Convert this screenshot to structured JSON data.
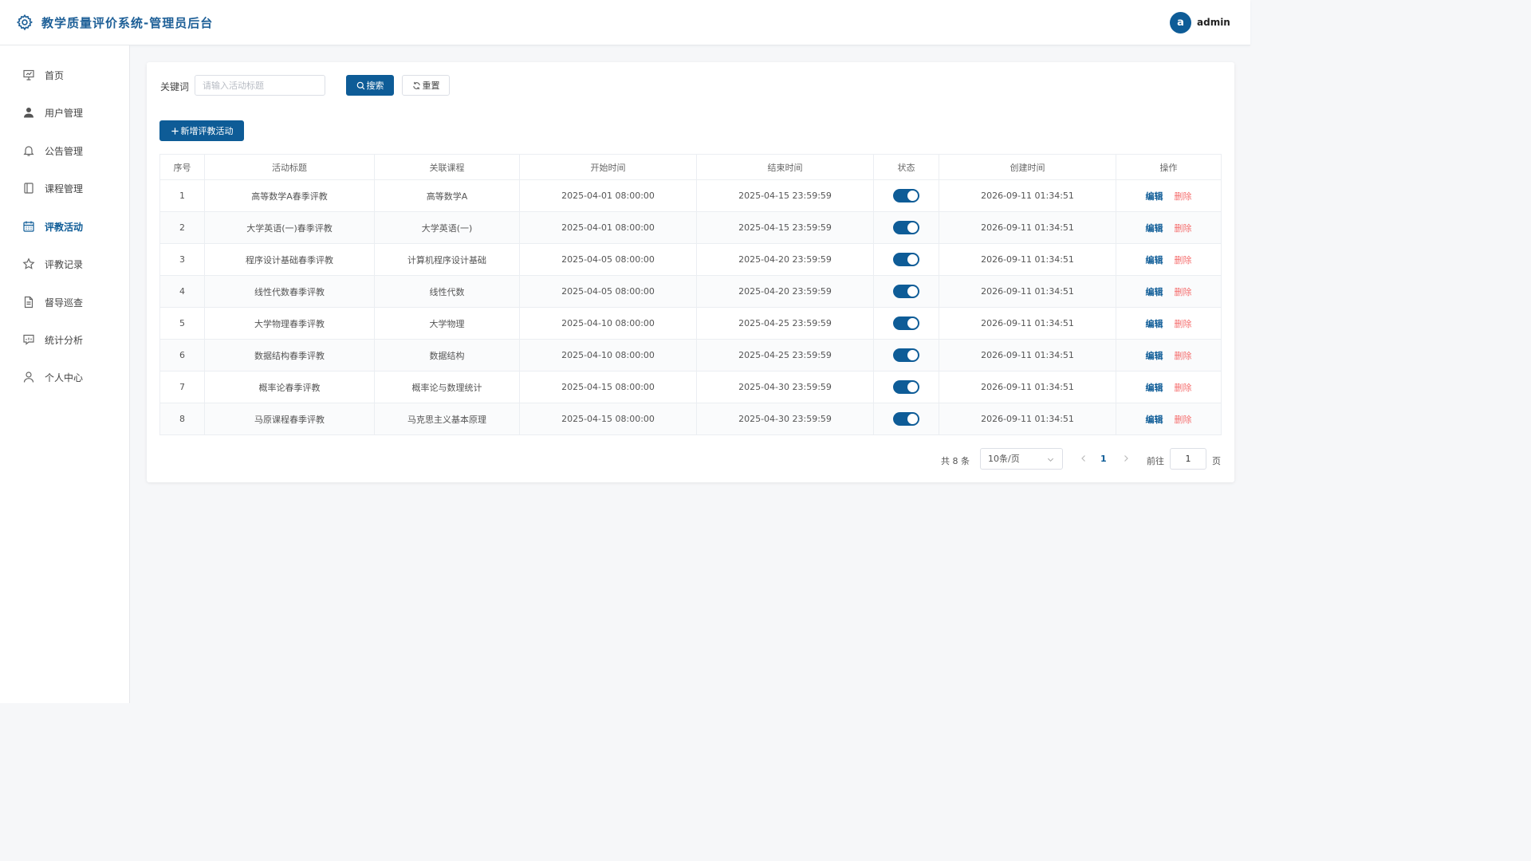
{
  "header": {
    "title": "教学质量评价系统-管理员后台",
    "avatar_letter": "a",
    "username": "admin"
  },
  "sidebar": {
    "items": [
      {
        "label": "首页",
        "icon": "presentation-icon"
      },
      {
        "label": "用户管理",
        "icon": "user-icon"
      },
      {
        "label": "公告管理",
        "icon": "bell-icon"
      },
      {
        "label": "课程管理",
        "icon": "notebook-icon"
      },
      {
        "label": "评教活动",
        "icon": "calendar-icon",
        "active": true
      },
      {
        "label": "评教记录",
        "icon": "star-icon"
      },
      {
        "label": "督导巡查",
        "icon": "document-icon"
      },
      {
        "label": "统计分析",
        "icon": "chat-chart-icon"
      },
      {
        "label": "个人中心",
        "icon": "user-outline-icon"
      }
    ]
  },
  "search": {
    "keyword_label": "关键词",
    "placeholder": "请输入活动标题",
    "value": "",
    "search_label": "搜索",
    "reset_label": "重置"
  },
  "toolbar": {
    "add_label": "新增评教活动"
  },
  "table": {
    "columns": [
      "序号",
      "活动标题",
      "关联课程",
      "开始时间",
      "结束时间",
      "状态",
      "创建时间",
      "操作"
    ],
    "edit_label": "编辑",
    "delete_label": "删除",
    "rows": [
      {
        "no": "1",
        "title": "高等数学A春季评教",
        "course": "高等数学A",
        "start": "2025-04-01 08:00:00",
        "end": "2025-04-15 23:59:59",
        "enabled": true,
        "created": "2026-09-11 01:34:51"
      },
      {
        "no": "2",
        "title": "大学英语(一)春季评教",
        "course": "大学英语(一)",
        "start": "2025-04-01 08:00:00",
        "end": "2025-04-15 23:59:59",
        "enabled": true,
        "created": "2026-09-11 01:34:51"
      },
      {
        "no": "3",
        "title": "程序设计基础春季评教",
        "course": "计算机程序设计基础",
        "start": "2025-04-05 08:00:00",
        "end": "2025-04-20 23:59:59",
        "enabled": true,
        "created": "2026-09-11 01:34:51"
      },
      {
        "no": "4",
        "title": "线性代数春季评教",
        "course": "线性代数",
        "start": "2025-04-05 08:00:00",
        "end": "2025-04-20 23:59:59",
        "enabled": true,
        "created": "2026-09-11 01:34:51"
      },
      {
        "no": "5",
        "title": "大学物理春季评教",
        "course": "大学物理",
        "start": "2025-04-10 08:00:00",
        "end": "2025-04-25 23:59:59",
        "enabled": true,
        "created": "2026-09-11 01:34:51"
      },
      {
        "no": "6",
        "title": "数据结构春季评教",
        "course": "数据结构",
        "start": "2025-04-10 08:00:00",
        "end": "2025-04-25 23:59:59",
        "enabled": true,
        "created": "2026-09-11 01:34:51"
      },
      {
        "no": "7",
        "title": "概率论春季评教",
        "course": "概率论与数理统计",
        "start": "2025-04-15 08:00:00",
        "end": "2025-04-30 23:59:59",
        "enabled": true,
        "created": "2026-09-11 01:34:51"
      },
      {
        "no": "8",
        "title": "马原课程春季评教",
        "course": "马克思主义基本原理",
        "start": "2025-04-15 08:00:00",
        "end": "2025-04-30 23:59:59",
        "enabled": true,
        "created": "2026-09-11 01:34:51"
      }
    ]
  },
  "pagination": {
    "total_text": "共 8 条",
    "page_size": "10条/页",
    "current_page": "1",
    "goto_prefix": "前往",
    "goto_value": "1",
    "goto_suffix": "页"
  },
  "colors": {
    "primary": "#0e5c97",
    "danger": "#f56c6c",
    "background": "#f6f7f9"
  }
}
